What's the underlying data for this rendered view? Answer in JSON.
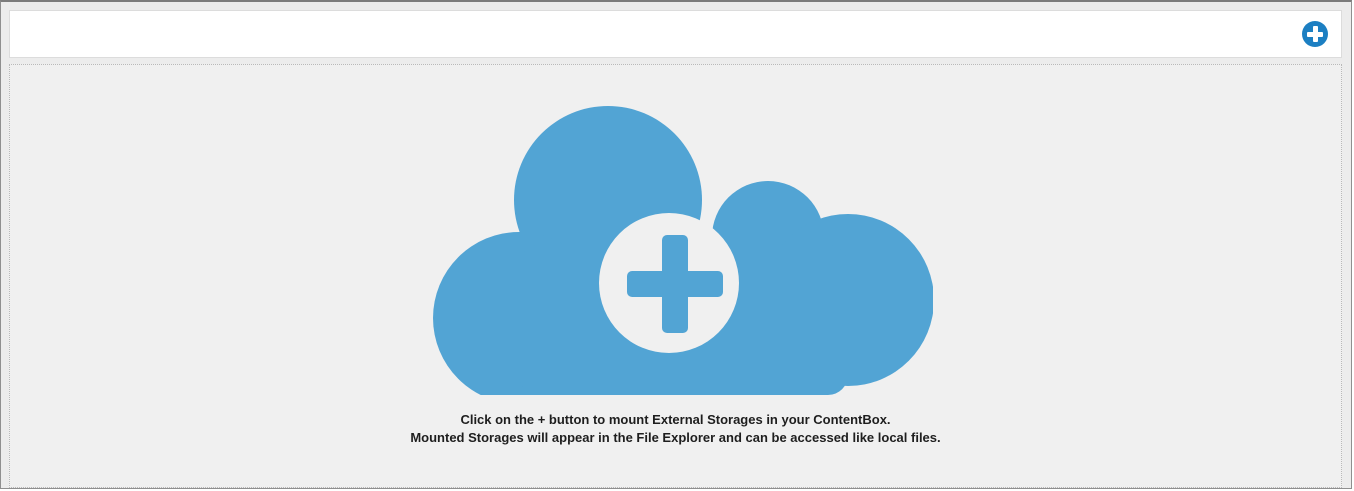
{
  "toolbar": {
    "add_button_icon": "plus-circle-icon",
    "accent_color": "#1c7fc2"
  },
  "empty_state": {
    "illustration_icon": "cloud-plus-icon",
    "cloud_color": "#52a4d4",
    "line1": "Click on the + button to mount External Storages in your ContentBox.",
    "line2": "Mounted Storages will appear in the File Explorer and can be accessed like local files."
  }
}
